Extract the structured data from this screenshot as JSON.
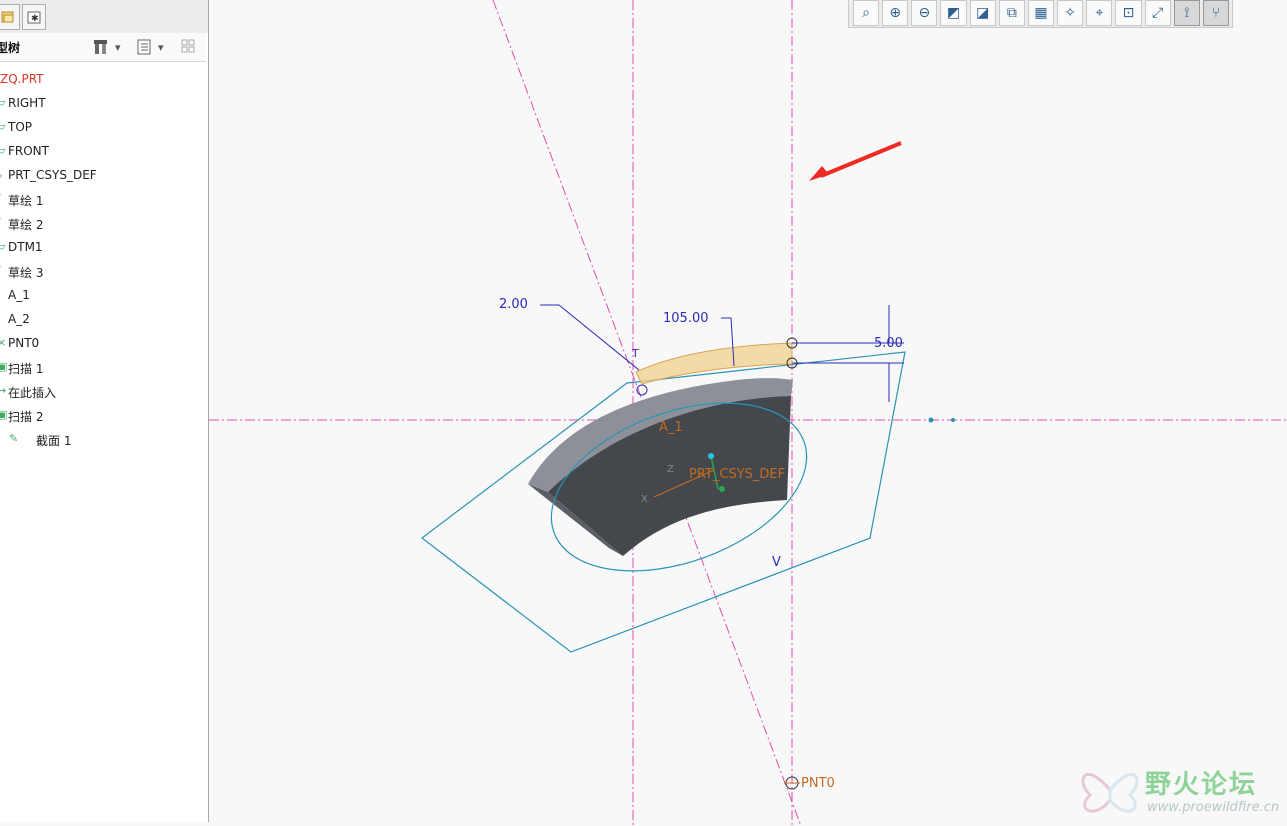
{
  "tree": {
    "title": "型树",
    "items": [
      {
        "label": "ZQ.PRT",
        "icon": "part-icon",
        "red": true
      },
      {
        "label": "RIGHT",
        "icon": "datum-plane-icon"
      },
      {
        "label": "TOP",
        "icon": "datum-plane-icon"
      },
      {
        "label": "FRONT",
        "icon": "datum-plane-icon"
      },
      {
        "label": "PRT_CSYS_DEF",
        "icon": "csys-icon"
      },
      {
        "label": "草绘 1",
        "icon": "sketch-icon"
      },
      {
        "label": "草绘 2",
        "icon": "sketch-icon"
      },
      {
        "label": "DTM1",
        "icon": "datum-plane-icon"
      },
      {
        "label": "草绘 3",
        "icon": "sketch-icon"
      },
      {
        "label": "A_1",
        "icon": "axis-icon"
      },
      {
        "label": "A_2",
        "icon": "axis-icon"
      },
      {
        "label": "PNT0",
        "icon": "datum-point-icon"
      },
      {
        "label": "扫描 1",
        "icon": "sweep-icon"
      },
      {
        "label": "在此插入",
        "icon": "insert-arrow-icon"
      },
      {
        "label": "扫描 2",
        "icon": "sweep-icon"
      },
      {
        "label": "截面 1",
        "icon": "section-icon",
        "sub": true
      }
    ]
  },
  "toolbar": {
    "buttons": [
      "refit-icon",
      "zoom-in-icon",
      "zoom-out-icon",
      "repaint-icon",
      "shading-icon",
      "saved-views-icon",
      "layers-icon",
      "datum-planes-toggle-icon",
      "datum-axes-toggle-icon",
      "point-display-icon",
      "csys-display-icon",
      "constraints-display-icon",
      "vertex-display-icon"
    ]
  },
  "canvas": {
    "dims": {
      "d1": "2.00",
      "d2": "105.00",
      "d3": "5.00"
    },
    "labels": {
      "axis": "A_1",
      "csys": "PRT_CSYS_DEF",
      "point": "PNT0",
      "v_marker": "V",
      "t_marker": "T",
      "z_marker": "Z",
      "x_marker": "X"
    }
  },
  "watermark": {
    "cn": "野火论坛",
    "url": "www.proewildfire.cn"
  },
  "colors": {
    "datum": "#e24fb0",
    "sketch": "#2b93b8",
    "solid": "#44474c",
    "highlight": "#f2d28c",
    "arrow": "#ee2a24",
    "dim": "#2b2bb8"
  }
}
